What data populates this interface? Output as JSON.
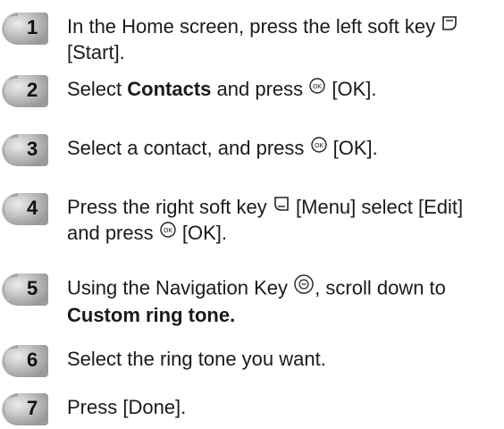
{
  "steps": [
    {
      "number": "1",
      "line1_pre": "In the Home screen, press the left soft key",
      "icon": "left-soft-key-icon",
      "line2": "[Start]."
    },
    {
      "number": "2",
      "pre": "Select",
      "bold": "Contacts",
      "post": "and press",
      "icon": "ok-key-icon",
      "tail": "[OK]."
    },
    {
      "number": "3",
      "pre": "Select a contact, and press",
      "icon": "ok-key-icon",
      "tail": "[OK]."
    },
    {
      "number": "4",
      "line1_pre": "Press the right soft key",
      "icon": "right-soft-key-icon",
      "line1_post": "[Menu] select [Edit]",
      "line2_pre": "and press",
      "icon2": "ok-key-icon",
      "line2_post": "[OK]."
    },
    {
      "number": "5",
      "line1_pre": "Using the Navigation Key",
      "icon": "navigation-key-icon",
      "line1_post": ", scroll down to",
      "line2_bold": "Custom ring tone."
    },
    {
      "number": "6",
      "text": "Select the ring tone you want."
    },
    {
      "number": "7",
      "text": "Press [Done]."
    }
  ]
}
